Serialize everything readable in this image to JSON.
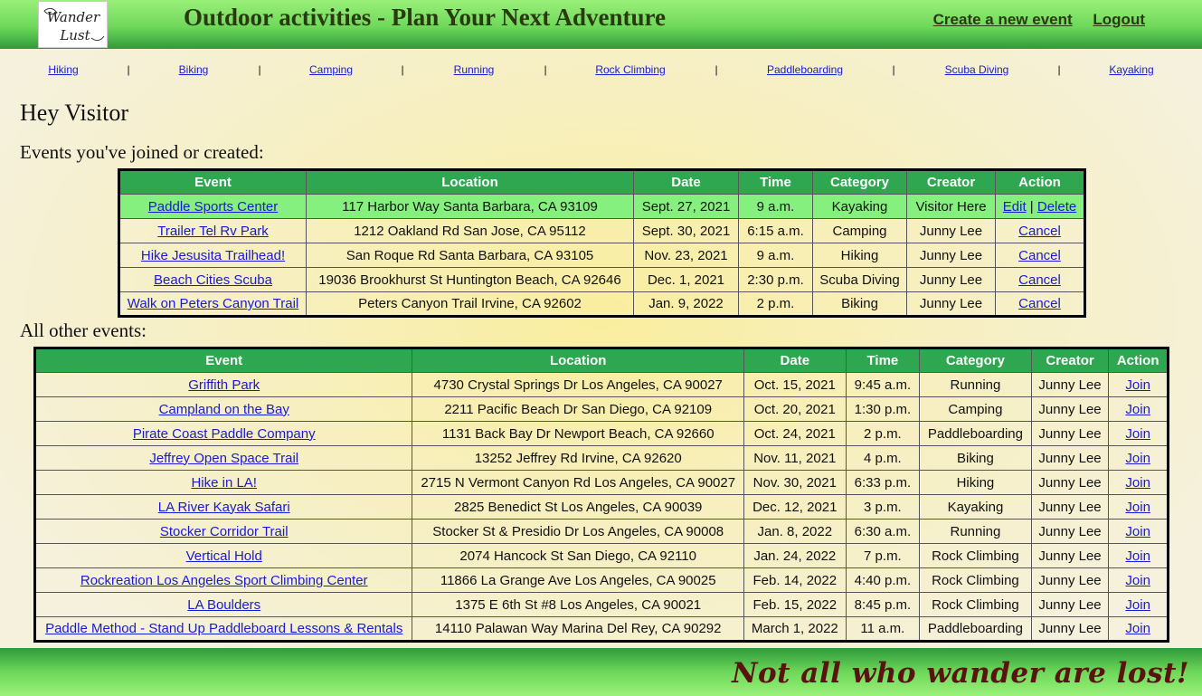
{
  "header": {
    "logo_text": "Wander Lust",
    "title": "Outdoor activities - Plan Your Next Adventure",
    "create_event": "Create a new event",
    "logout": "Logout"
  },
  "nav": {
    "items": [
      "Hiking",
      "Biking",
      "Camping",
      "Running",
      "Rock Climbing",
      "Paddleboarding",
      "Scuba Diving",
      "Kayaking"
    ],
    "separator": "|"
  },
  "greeting": "Hey Visitor",
  "joined": {
    "title": "Events you've joined or created:",
    "columns": [
      "Event",
      "Location",
      "Date",
      "Time",
      "Category",
      "Creator",
      "Action"
    ],
    "rows": [
      {
        "event": "Paddle Sports Center",
        "location": "117 Harbor Way Santa Barbara, CA 93109",
        "date": "Sept. 27, 2021",
        "time": "9 a.m.",
        "category": "Kayaking",
        "creator": "Visitor Here",
        "actions": [
          "Edit",
          "Delete"
        ]
      },
      {
        "event": "Trailer Tel Rv Park",
        "location": "1212 Oakland Rd San Jose, CA 95112",
        "date": "Sept. 30, 2021",
        "time": "6:15 a.m.",
        "category": "Camping",
        "creator": "Junny Lee",
        "actions": [
          "Cancel"
        ]
      },
      {
        "event": "Hike Jesusita Trailhead!",
        "location": "San Roque Rd Santa Barbara, CA 93105",
        "date": "Nov. 23, 2021",
        "time": "9 a.m.",
        "category": "Hiking",
        "creator": "Junny Lee",
        "actions": [
          "Cancel"
        ]
      },
      {
        "event": "Beach Cities Scuba",
        "location": "19036 Brookhurst St Huntington Beach, CA 92646",
        "date": "Dec. 1, 2021",
        "time": "2:30 p.m.",
        "category": "Scuba Diving",
        "creator": "Junny Lee",
        "actions": [
          "Cancel"
        ]
      },
      {
        "event": "Walk on Peters Canyon Trail",
        "location": "Peters Canyon Trail Irvine, CA 92602",
        "date": "Jan. 9, 2022",
        "time": "2 p.m.",
        "category": "Biking",
        "creator": "Junny Lee",
        "actions": [
          "Cancel"
        ]
      }
    ]
  },
  "others": {
    "title": "All other events:",
    "columns": [
      "Event",
      "Location",
      "Date",
      "Time",
      "Category",
      "Creator",
      "Action"
    ],
    "rows": [
      {
        "event": "Griffith Park",
        "location": "4730 Crystal Springs Dr Los Angeles, CA 90027",
        "date": "Oct. 15, 2021",
        "time": "9:45 a.m.",
        "category": "Running",
        "creator": "Junny Lee",
        "actions": [
          "Join"
        ]
      },
      {
        "event": "Campland on the Bay",
        "location": "2211 Pacific Beach Dr San Diego, CA 92109",
        "date": "Oct. 20, 2021",
        "time": "1:30 p.m.",
        "category": "Camping",
        "creator": "Junny Lee",
        "actions": [
          "Join"
        ]
      },
      {
        "event": "Pirate Coast Paddle Company",
        "location": "1131 Back Bay Dr Newport Beach, CA 92660",
        "date": "Oct. 24, 2021",
        "time": "2 p.m.",
        "category": "Paddleboarding",
        "creator": "Junny Lee",
        "actions": [
          "Join"
        ]
      },
      {
        "event": "Jeffrey Open Space Trail",
        "location": "13252 Jeffrey Rd Irvine, CA 92620",
        "date": "Nov. 11, 2021",
        "time": "4 p.m.",
        "category": "Biking",
        "creator": "Junny Lee",
        "actions": [
          "Join"
        ]
      },
      {
        "event": "Hike in LA!",
        "location": "2715 N Vermont Canyon Rd Los Angeles, CA 90027",
        "date": "Nov. 30, 2021",
        "time": "6:33 p.m.",
        "category": "Hiking",
        "creator": "Junny Lee",
        "actions": [
          "Join"
        ]
      },
      {
        "event": "LA River Kayak Safari",
        "location": "2825 Benedict St Los Angeles, CA 90039",
        "date": "Dec. 12, 2021",
        "time": "3 p.m.",
        "category": "Kayaking",
        "creator": "Junny Lee",
        "actions": [
          "Join"
        ]
      },
      {
        "event": "Stocker Corridor Trail",
        "location": "Stocker St & Presidio Dr Los Angeles, CA 90008",
        "date": "Jan. 8, 2022",
        "time": "6:30 a.m.",
        "category": "Running",
        "creator": "Junny Lee",
        "actions": [
          "Join"
        ]
      },
      {
        "event": "Vertical Hold",
        "location": "2074 Hancock St San Diego, CA 92110",
        "date": "Jan. 24, 2022",
        "time": "7 p.m.",
        "category": "Rock Climbing",
        "creator": "Junny Lee",
        "actions": [
          "Join"
        ]
      },
      {
        "event": "Rockreation Los Angeles Sport Climbing Center",
        "location": "11866 La Grange Ave Los Angeles, CA 90025",
        "date": "Feb. 14, 2022",
        "time": "4:40 p.m.",
        "category": "Rock Climbing",
        "creator": "Junny Lee",
        "actions": [
          "Join"
        ]
      },
      {
        "event": "LA Boulders",
        "location": "1375 E 6th St #8 Los Angeles, CA 90021",
        "date": "Feb. 15, 2022",
        "time": "8:45 p.m.",
        "category": "Rock Climbing",
        "creator": "Junny Lee",
        "actions": [
          "Join"
        ]
      },
      {
        "event": "Paddle Method - Stand Up Paddleboard Lessons & Rentals",
        "location": "14110 Palawan Way Marina Del Rey, CA 90292",
        "date": "March 1, 2022",
        "time": "11 a.m.",
        "category": "Paddleboarding",
        "creator": "Junny Lee",
        "actions": [
          "Join"
        ]
      }
    ]
  },
  "footer": {
    "motto": "Not all who wander are lost!"
  },
  "colors": {
    "header_green": "#6ed85a",
    "table_header": "#2fa650",
    "highlight_row": "#86f07e",
    "link": "#1a1ad0",
    "motto": "#5a1410"
  }
}
